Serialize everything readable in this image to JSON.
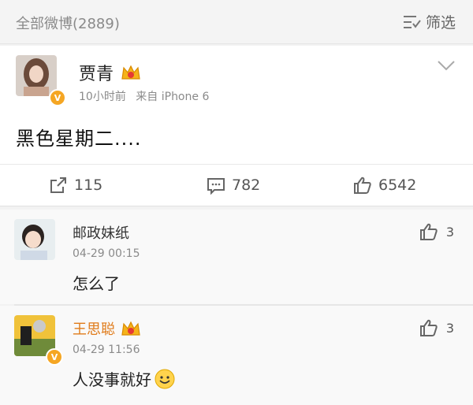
{
  "header": {
    "all_weibo_label": "全部微博(2889)",
    "filter_label": "筛选"
  },
  "post": {
    "author": "贾青",
    "time": "10小时前",
    "source": "来自 iPhone 6",
    "text": "黑色星期二....",
    "verified_badge": "V"
  },
  "actions": {
    "repost_count": "115",
    "comment_count": "782",
    "like_count": "6542"
  },
  "comments": [
    {
      "author": "邮政妹纸",
      "time": "04-29 00:15",
      "text": "怎么了",
      "likes": "3"
    },
    {
      "author": "王思聪",
      "time": "04-29 11:56",
      "text": "人没事就好",
      "likes": "3",
      "verified_badge": "V"
    }
  ],
  "colors": {
    "verified": "#f5a623",
    "vip_name": "#e07b1a"
  }
}
